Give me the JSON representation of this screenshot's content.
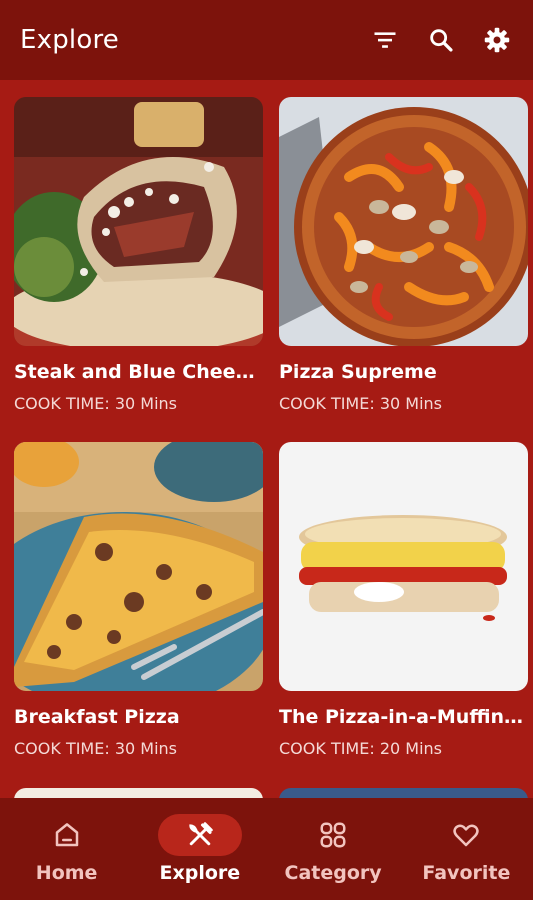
{
  "appbar": {
    "title": "Explore",
    "actions": [
      {
        "name": "filter-icon"
      },
      {
        "name": "search-icon"
      },
      {
        "name": "settings-icon"
      }
    ]
  },
  "recipes": [
    {
      "title": "Steak and Blue Chees...",
      "cook_time": "COOK TIME: 30 Mins",
      "image": "steak-sandwich"
    },
    {
      "title": "Pizza Supreme",
      "cook_time": "COOK TIME: 30 Mins",
      "image": "pizza-supreme"
    },
    {
      "title": "Breakfast Pizza",
      "cook_time": "COOK TIME: 30 Mins",
      "image": "breakfast-pizza"
    },
    {
      "title": "The Pizza-in-a-Muffin ...",
      "cook_time": "COOK TIME: 20 Mins",
      "image": "pizza-muffin"
    }
  ],
  "bottom_nav": {
    "items": [
      {
        "label": "Home",
        "icon": "home-icon",
        "active": false
      },
      {
        "label": "Explore",
        "icon": "fork-knife-icon",
        "active": true
      },
      {
        "label": "Category",
        "icon": "grid-icon",
        "active": false
      },
      {
        "label": "Favorite",
        "icon": "heart-icon",
        "active": false
      }
    ]
  },
  "colors": {
    "background": "#a61b14",
    "bars": "#7d130c",
    "active_pill": "#b8261b",
    "text": "#ffffff"
  }
}
